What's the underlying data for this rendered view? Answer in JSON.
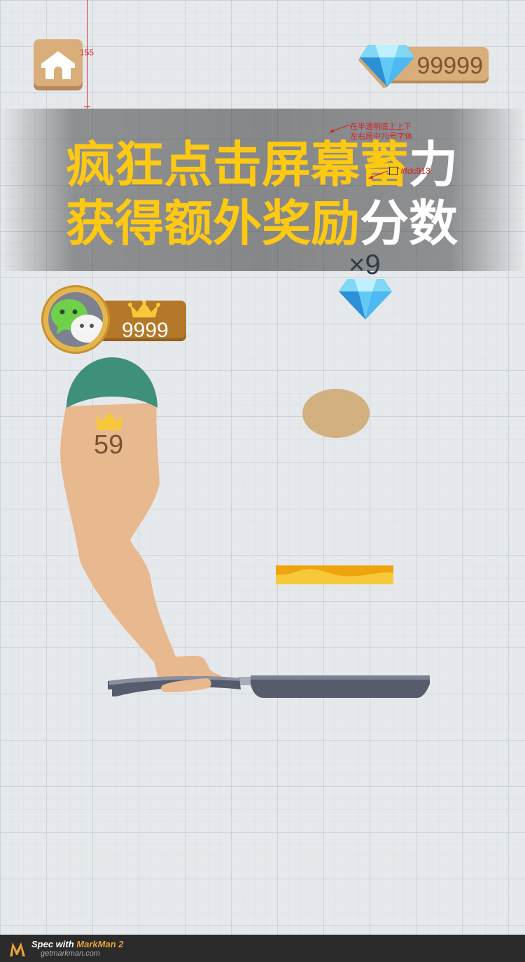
{
  "header": {
    "home_icon": "home-icon",
    "gem_count": "99999",
    "gem_icon": "diamond-icon"
  },
  "measurement": {
    "label": "155"
  },
  "banner": {
    "line1_yellow": "疯狂点击屏幕蓄",
    "line1_white": "力",
    "line2_yellow": "获得额外奖励分",
    "line2_white": "分数",
    "line2_yellow_trim": "获得额外奖励",
    "text_color": "#fdc913"
  },
  "annotation": {
    "note": "在半透明底上上下左右居中70号字体",
    "color_label": "#fdc913"
  },
  "reward": {
    "multiplier": "×9",
    "icon": "diamond-icon"
  },
  "player": {
    "avatar_icon": "wechat-icon",
    "crown_icon": "crown-icon",
    "score": "9999"
  },
  "game": {
    "floating_score": "59",
    "crown_icon": "crown-icon"
  },
  "footer": {
    "title_prefix": "Spec with ",
    "title_brand": "MarkMan 2",
    "url": "getmarkman.com"
  },
  "colors": {
    "accent_yellow": "#fdc913",
    "wood": "#d9ae7a",
    "badge_brown": "#b47828",
    "arm_skin": "#e8b88e",
    "cap_green": "#3f907b",
    "pan_gray": "#575c6c",
    "pancake": "#d2b080",
    "butter": "#f0b828"
  }
}
